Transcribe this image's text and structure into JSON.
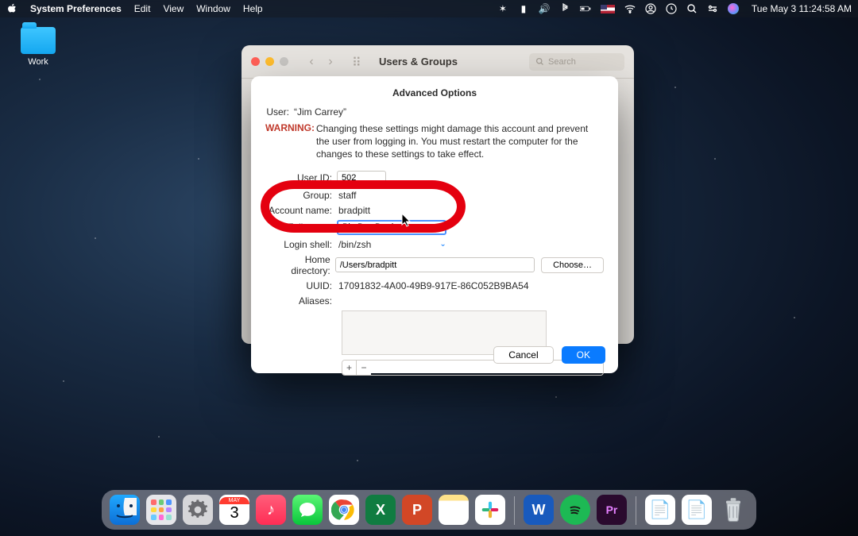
{
  "menubar": {
    "app_name": "System Preferences",
    "items": [
      "Edit",
      "View",
      "Window",
      "Help"
    ],
    "clock": "Tue May 3  11:24:58 AM"
  },
  "desktop": {
    "folder_label": "Work"
  },
  "parent_window": {
    "title": "Users & Groups",
    "search_placeholder": "Search"
  },
  "sheet": {
    "title": "Advanced Options",
    "user_label": "User:",
    "user_value": "“Jim Carrey”",
    "warning_label": "WARNING:",
    "warning_text": "Changing these settings might damage this account and prevent the user from logging in. You must restart the computer for the changes to these settings to take effect.",
    "fields": {
      "user_id": {
        "label": "User ID:",
        "value": "502"
      },
      "group": {
        "label": "Group:",
        "value": "staff"
      },
      "account_name": {
        "label": "Account name:",
        "value": "bradpitt"
      },
      "full_name": {
        "label": "Full name:",
        "value": "Big Boy Brad"
      },
      "login_shell": {
        "label": "Login shell:",
        "value": "/bin/zsh"
      },
      "home_dir": {
        "label": "Home directory:",
        "value": "/Users/bradpitt"
      },
      "uuid": {
        "label": "UUID:",
        "value": "17091832-4A00-49B9-917E-86C052B9BA54"
      },
      "aliases": {
        "label": "Aliases:"
      }
    },
    "choose_button": "Choose…",
    "cancel": "Cancel",
    "ok": "OK"
  },
  "dock": {
    "apps": [
      "Finder",
      "Launchpad",
      "System Preferences",
      "Calendar",
      "Music",
      "Messages",
      "Chrome",
      "Excel",
      "PowerPoint",
      "Notes",
      "Slack",
      "Word",
      "Spotify",
      "Premiere"
    ],
    "calendar_day": "3",
    "calendar_month": "MAY"
  }
}
